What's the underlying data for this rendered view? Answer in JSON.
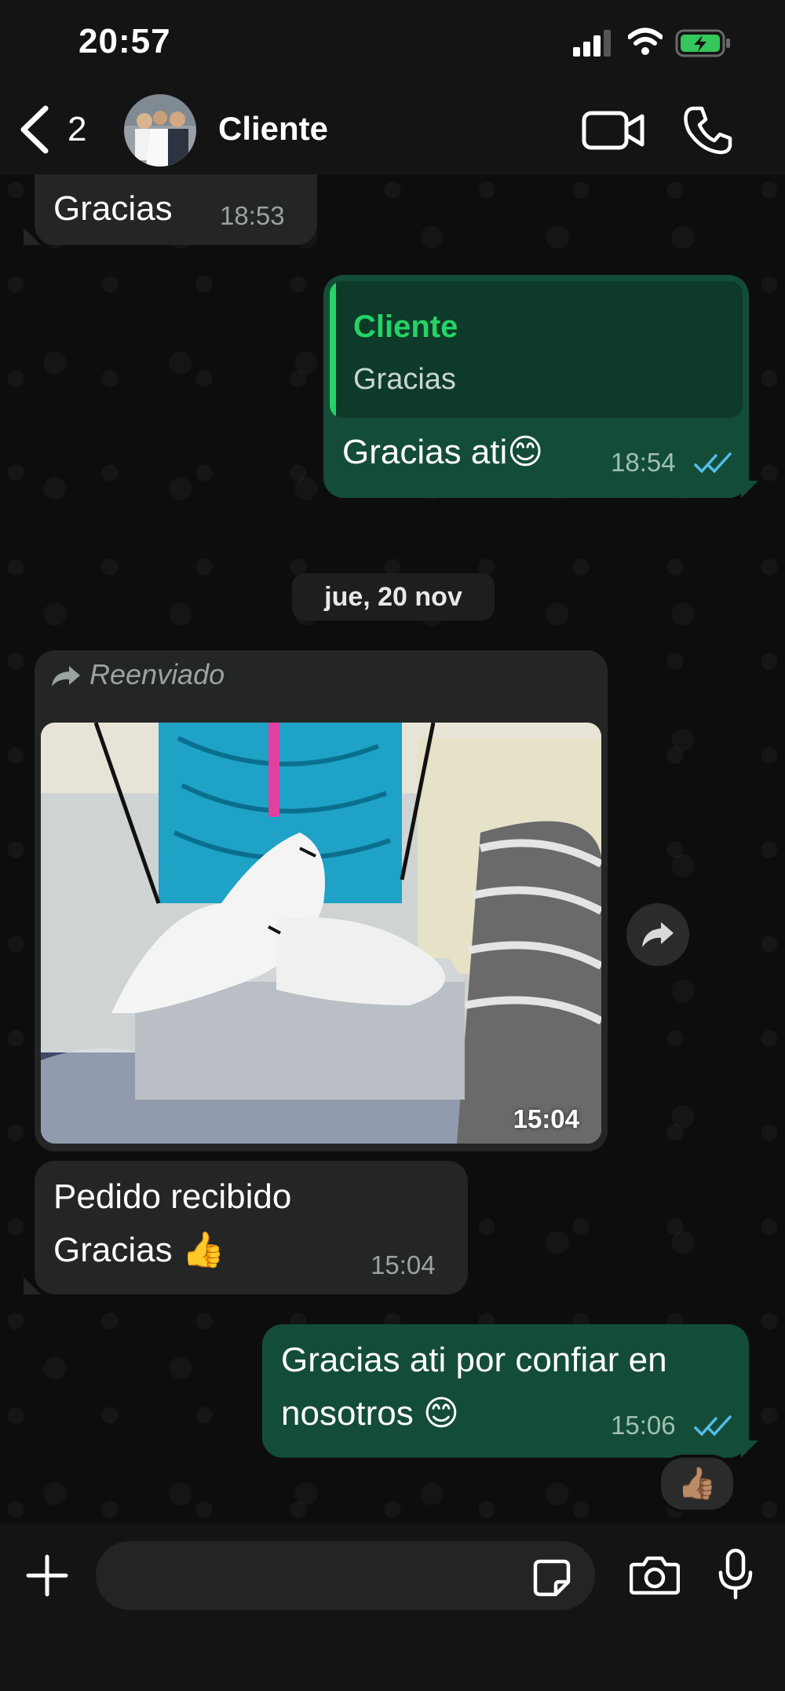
{
  "status_bar": {
    "time": "20:57"
  },
  "header": {
    "back_count": "2",
    "contact_name": "Cliente"
  },
  "messages": {
    "m1": {
      "text": "Gracias",
      "time": "18:53"
    },
    "m2": {
      "quote_name": "Cliente",
      "quote_text": "Gracias",
      "text": "Gracias ati😊",
      "time": "18:54"
    },
    "date_separator": "jue, 20 nov",
    "m3": {
      "forwarded_label": "Reenviado",
      "time": "15:04"
    },
    "m4": {
      "line1": "Pedido recibido",
      "line2": "Gracias 👍",
      "time": "15:04"
    },
    "m5": {
      "line1": "Gracias ati por confiar en",
      "line2": "nosotros 😊",
      "time": "15:06",
      "reaction": "👍🏽"
    }
  },
  "colors": {
    "incoming_bubble": "#242626",
    "outgoing_bubble": "#144d37",
    "accent_green": "#25d366",
    "read_ticks": "#53bdeb"
  }
}
